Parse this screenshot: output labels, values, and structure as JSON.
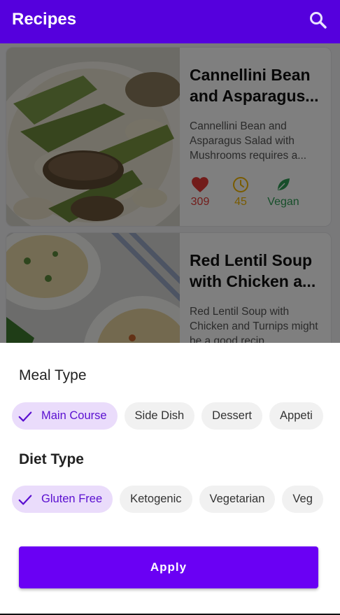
{
  "app_bar": {
    "title": "Recipes",
    "search_icon": "search-icon"
  },
  "recipes": [
    {
      "title": "Cannellini Bean and Asparagus...",
      "description": "Cannellini Bean and Asparagus Salad with Mushrooms requires a...",
      "likes": "309",
      "minutes": "45",
      "diet_label": "Vegan",
      "icons": [
        "heart-icon",
        "clock-icon",
        "leaf-icon"
      ]
    },
    {
      "title": "Red Lentil Soup with Chicken a...",
      "description": "Red Lentil Soup with Chicken and Turnips might be a good recip...",
      "likes": "",
      "minutes": "",
      "diet_label": ""
    }
  ],
  "filters": {
    "meal_type": {
      "title": "Meal Type",
      "chips": [
        "Main Course",
        "Side Dish",
        "Dessert",
        "Appeti"
      ],
      "selected": "Main Course"
    },
    "diet_type": {
      "title": "Diet Type",
      "chips": [
        "Gluten Free",
        "Ketogenic",
        "Vegetarian",
        "Veg"
      ],
      "selected": "Gluten Free"
    },
    "apply_label": "Apply"
  },
  "colors": {
    "primary": "#6a00f4",
    "chip_selected_bg": "#eadcfb",
    "heart": "#e53935",
    "clock": "#f2b600",
    "vegan": "#2e9d55"
  }
}
